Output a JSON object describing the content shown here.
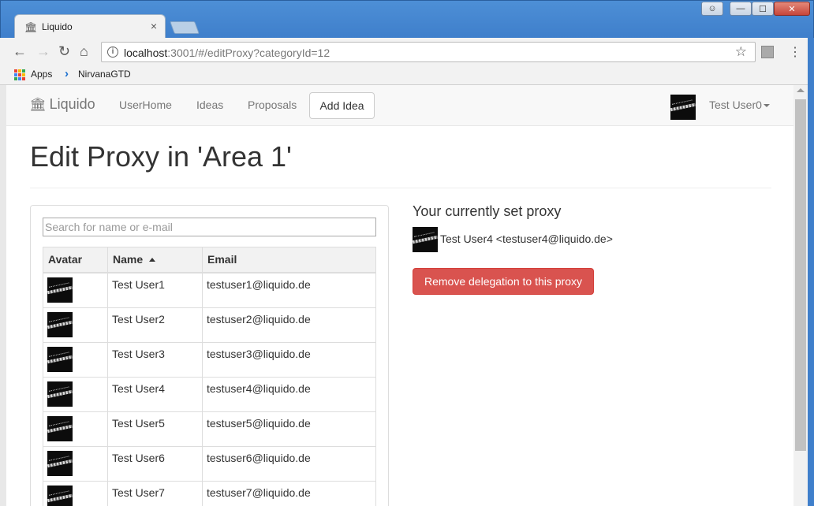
{
  "browser": {
    "tab_title": "Liquido",
    "tab_close": "×",
    "url_host": "localhost",
    "url_rest": ":3001/#/editProxy?categoryId=12",
    "bookmarks": [
      {
        "label": "Apps"
      },
      {
        "label": "NirvanaGTD"
      }
    ],
    "window_controls": [
      "—",
      "☐",
      "✕"
    ]
  },
  "navbar": {
    "brand": "Liquido",
    "links": [
      "UserHome",
      "Ideas",
      "Proposals"
    ],
    "add_idea": "Add Idea",
    "user": "Test User0"
  },
  "page": {
    "title": "Edit Proxy in 'Area 1'"
  },
  "search": {
    "placeholder": "Search for name or e-mail"
  },
  "table": {
    "headers": [
      "Avatar",
      "Name",
      "Email"
    ],
    "sort_column": "Name",
    "sort_direction": "ascending",
    "rows": [
      {
        "name": "Test User1",
        "email": "testuser1@liquido.de"
      },
      {
        "name": "Test User2",
        "email": "testuser2@liquido.de"
      },
      {
        "name": "Test User3",
        "email": "testuser3@liquido.de"
      },
      {
        "name": "Test User4",
        "email": "testuser4@liquido.de"
      },
      {
        "name": "Test User5",
        "email": "testuser5@liquido.de"
      },
      {
        "name": "Test User6",
        "email": "testuser6@liquido.de"
      },
      {
        "name": "Test User7",
        "email": "testuser7@liquido.de"
      }
    ]
  },
  "proxy": {
    "heading": "Your currently set proxy",
    "user": "Test User4 <testuser4@liquido.de>",
    "remove_button": "Remove delegation to this proxy"
  },
  "colors": {
    "danger": "#d9534f",
    "navbar_bg": "#f8f8f8",
    "titlebar": "#4d8fd6"
  },
  "icons": {
    "brand": "bank-icon",
    "back": "back-arrow-icon",
    "forward": "forward-arrow-icon",
    "reload": "reload-icon",
    "home": "home-icon",
    "info": "info-icon",
    "bookmark": "star-icon",
    "menu": "kebab-menu-icon",
    "apps": "apps-grid-icon",
    "sort": "sort-up-icon"
  }
}
